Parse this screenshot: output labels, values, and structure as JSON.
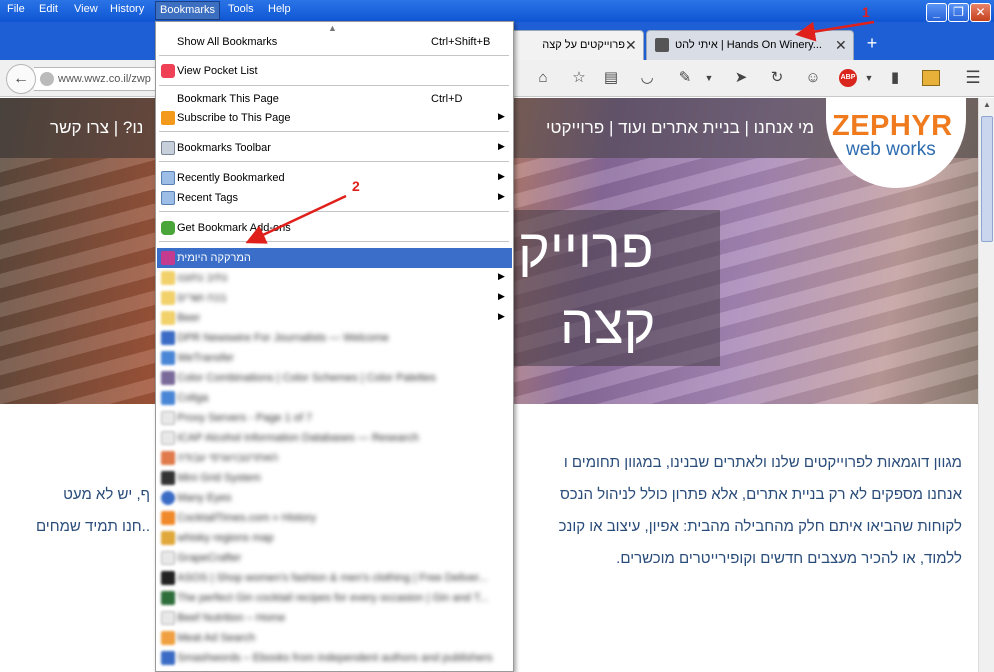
{
  "menubar": {
    "items": [
      "File",
      "Edit",
      "View",
      "History",
      "Bookmarks",
      "Tools",
      "Help"
    ],
    "active": "Bookmarks"
  },
  "window_controls": {
    "minimize": "_",
    "maximize": "❐",
    "close": "✕"
  },
  "tabs": [
    {
      "title": "פרוייקטים על קצה",
      "close": "✕"
    },
    {
      "title": "איתי להט | Hands On Winery...",
      "close": "✕"
    }
  ],
  "new_tab_label": "+",
  "navbar": {
    "back": "←",
    "url": "www.wwz.co.il/zwp",
    "abp_label": "ABP"
  },
  "website": {
    "nav_text": "מי אנחנו | בניית אתרים ועוד | פרוייקטי",
    "nav_text_left": "נו? | צרו קשר",
    "logo_top": "ZEPHYR",
    "logo_bottom": "web works",
    "hero_line1": "פרוייק",
    "hero_line2": "קצה",
    "body_lines": [
      "מגוון דוגמאות לפרוייקטים שלנו ולאתרים שבנינו, במגוון תחומים ו",
      "אנחנו מספקים לא רק בניית אתרים, אלא פתרון כולל לניהול הנכס",
      "לקוחות שהביאו איתם חלק מהחבילה מהבית: אפיון, עיצוב או קונכ",
      "ללמוד, או להכיר מעצבים חדשים וקופירייטרים מוכשרים."
    ],
    "body_lines_left": [
      "ף, יש לא מעט",
      "..חנו תמיד שמחים"
    ]
  },
  "bookmarks_menu": {
    "show_all": {
      "label": "Show All Bookmarks",
      "shortcut": "Ctrl+Shift+B"
    },
    "pocket": {
      "label": "View Pocket List"
    },
    "bookmark_page": {
      "label": "Bookmark This Page",
      "shortcut": "Ctrl+D"
    },
    "subscribe": {
      "label": "Subscribe to This Page"
    },
    "toolbar": {
      "label": "Bookmarks Toolbar"
    },
    "recent_bookmarked": {
      "label": "Recently Bookmarked"
    },
    "recent_tags": {
      "label": "Recent Tags"
    },
    "get_addons": {
      "label": "Get Bookmark Add-ons"
    },
    "highlighted": {
      "label": "המרקקה היומית"
    },
    "blurred_items": [
      "נתיב נתוננו",
      "בכה ושרים",
      "Beer",
      "DPR Newswire For Journalists — Welcome",
      "WeTransfer",
      "Color Combinations | Color Schemes | Color Palettes",
      "Coliga",
      "Proxy Servers - Page 1 of 7",
      "ICAP Alcohol Information Databases — Research",
      "האתרטבויוגרפי עבודה",
      "Mini Grid System",
      "Many Eyes",
      "CocktailTimes.com » History",
      "whisky regions map",
      "GrapeCrafter",
      "ASOS | Shop women's fashion & men's clothing | Free Deliver...",
      "The perfect Gin cocktail recipes for every occasion | Gin and T...",
      "Beef Nutrition – Home",
      "Meat Ad Search",
      "Smashwords – Ebooks from independent authors and publishers"
    ],
    "submenu_glyph": "▶"
  },
  "annotations": {
    "one": "1",
    "two": "2"
  },
  "colors": {
    "title_bar": "#0f55d4",
    "highlight": "#3a6ec8",
    "annotation": "#e0201a",
    "logo_orange": "#f07b1e",
    "logo_blue": "#2d6cb0"
  }
}
